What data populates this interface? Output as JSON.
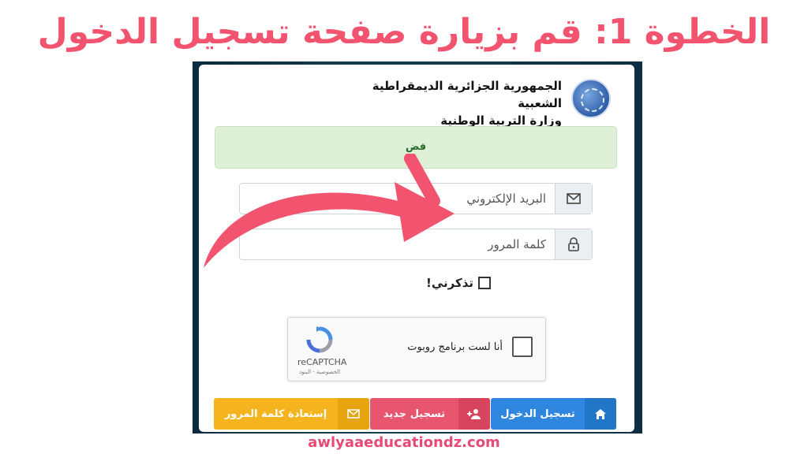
{
  "headline": "الخطوة 1: قم بزيارة صفحة تسجيل الدخول",
  "header": {
    "line1": "الجمهورية الجزائرية الديمقراطية الشعبية",
    "line2": "وزارة التربية الوطنية"
  },
  "alert": {
    "text": "فض"
  },
  "form": {
    "email_placeholder": "البريد الإلكتروني",
    "password_placeholder": "كلمة المرور",
    "remember_label": "تذكرني!"
  },
  "captcha": {
    "label": "أنا لست برنامج روبوت",
    "brand": "reCAPTCHA",
    "links": "الخصوصية - البنود"
  },
  "buttons": {
    "login": "تسجيل الدخول",
    "register": "تسجيل جديد",
    "reset": "إستعادة كلمة المرور"
  },
  "footer": "awlyaaeducationdz.com",
  "colors": {
    "headline": "#f2546f",
    "login": "#2e86de",
    "register": "#e8556f",
    "reset": "#f5b41d",
    "arrow": "#f2546f"
  },
  "icons": {
    "email": "envelope-icon",
    "password": "lock-icon",
    "login": "home-icon",
    "register": "user-plus-icon",
    "reset": "envelope-icon"
  }
}
